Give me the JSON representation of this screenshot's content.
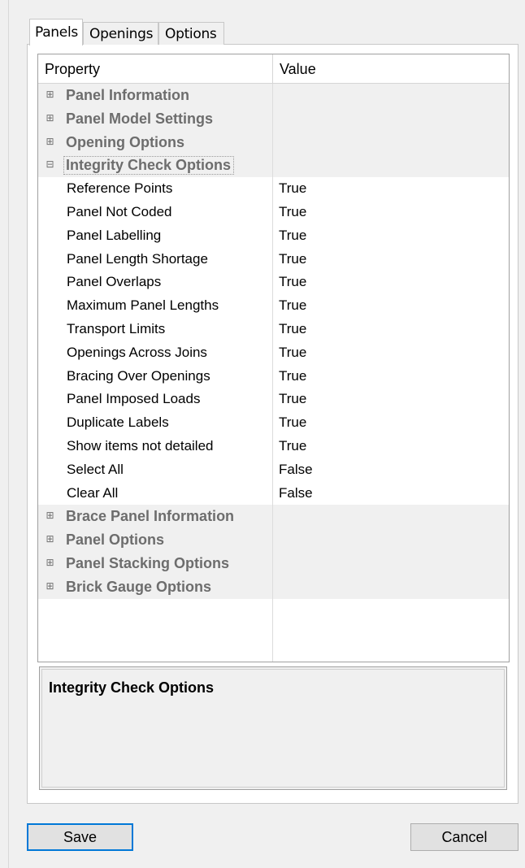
{
  "tabs": [
    {
      "label": "Panels",
      "active": true
    },
    {
      "label": "Openings",
      "active": false
    },
    {
      "label": "Options",
      "active": false
    }
  ],
  "grid": {
    "columns": {
      "property": "Property",
      "value": "Value"
    },
    "rows": [
      {
        "type": "category",
        "label": "Panel Information",
        "expander": "⊞"
      },
      {
        "type": "category",
        "label": "Panel Model Settings",
        "expander": "⊞"
      },
      {
        "type": "category",
        "label": "Opening Options",
        "expander": "⊞"
      },
      {
        "type": "category",
        "label": "Integrity Check Options",
        "expander": "⊟",
        "selected": true
      },
      {
        "type": "property",
        "label": "Reference Points",
        "value": "True"
      },
      {
        "type": "property",
        "label": "Panel Not Coded",
        "value": "True"
      },
      {
        "type": "property",
        "label": "Panel Labelling",
        "value": "True"
      },
      {
        "type": "property",
        "label": "Panel Length Shortage",
        "value": "True"
      },
      {
        "type": "property",
        "label": "Panel Overlaps",
        "value": "True"
      },
      {
        "type": "property",
        "label": "Maximum Panel Lengths",
        "value": "True"
      },
      {
        "type": "property",
        "label": "Transport Limits",
        "value": "True"
      },
      {
        "type": "property",
        "label": "Openings Across Joins",
        "value": "True"
      },
      {
        "type": "property",
        "label": "Bracing Over Openings",
        "value": "True"
      },
      {
        "type": "property",
        "label": "Panel Imposed Loads",
        "value": "True"
      },
      {
        "type": "property",
        "label": "Duplicate Labels",
        "value": "True"
      },
      {
        "type": "property",
        "label": "Show items not detailed",
        "value": "True"
      },
      {
        "type": "property",
        "label": "Select All",
        "value": "False"
      },
      {
        "type": "property",
        "label": "Clear All",
        "value": "False"
      },
      {
        "type": "category",
        "label": "Brace Panel Information",
        "expander": "⊞"
      },
      {
        "type": "category",
        "label": "Panel Options",
        "expander": "⊞"
      },
      {
        "type": "category",
        "label": "Panel Stacking Options",
        "expander": "⊞"
      },
      {
        "type": "category",
        "label": "Brick Gauge Options",
        "expander": "⊞"
      }
    ]
  },
  "description": {
    "title": "Integrity Check Options"
  },
  "buttons": {
    "save": "Save",
    "cancel": "Cancel"
  }
}
